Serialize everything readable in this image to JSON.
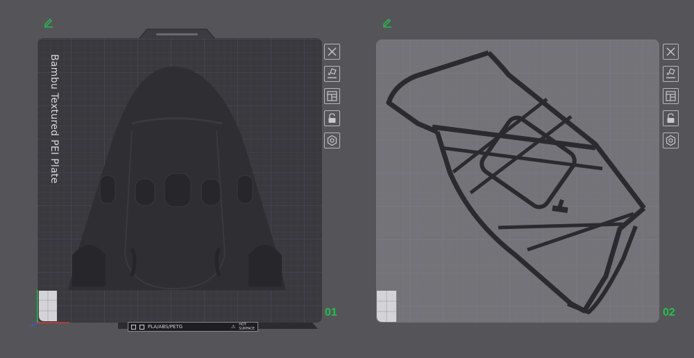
{
  "plates": [
    {
      "number": "01",
      "name": "Bambu Textured PEI Plate",
      "bottom_label": {
        "filament_types": "PLA/ABS/PETG",
        "surface_line1": "HOT",
        "surface_line2": "SURFACE"
      },
      "tools": [
        "close-icon",
        "auto-orient-icon",
        "arrange-icon",
        "lock-icon",
        "settings-icon"
      ]
    },
    {
      "number": "02",
      "tools": [
        "close-icon",
        "auto-orient-icon",
        "arrange-icon",
        "lock-icon",
        "settings-icon"
      ]
    }
  ],
  "colors": {
    "background": "#555559",
    "plate1_surface": "#39393e",
    "plate2_surface": "#737378",
    "model_fill": "#2f2f33",
    "accent_green": "#23c04f",
    "icon_stroke": "#b9b9bd"
  }
}
